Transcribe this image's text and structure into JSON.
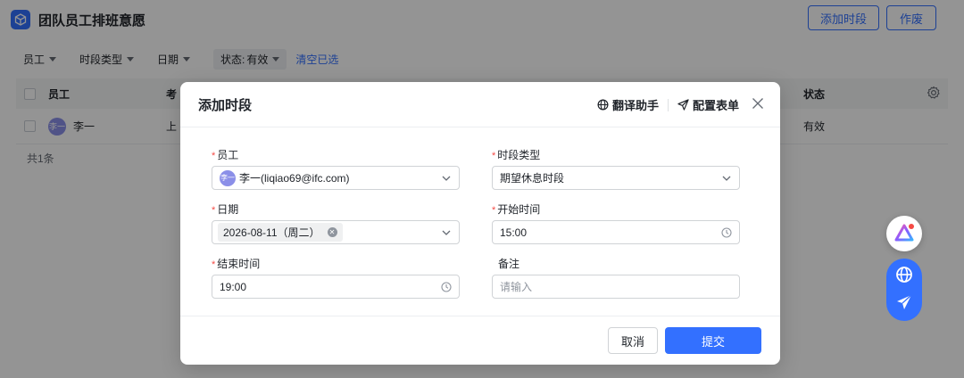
{
  "app": {
    "title": "团队员工排班意愿"
  },
  "toolbar": {
    "add_label": "添加时段",
    "void_label": "作废"
  },
  "filters": {
    "employee": "员工",
    "period_type": "时段类型",
    "date": "日期",
    "status_label": "状态:",
    "status_value": "有效",
    "clear": "清空已选"
  },
  "table": {
    "columns": {
      "employee": "员工",
      "attendance": "考",
      "status": "状态"
    },
    "rows": [
      {
        "avatar": "李一",
        "name": "李一",
        "attendance": "上",
        "status": "有效"
      }
    ],
    "total": "共1条"
  },
  "modal": {
    "title": "添加时段",
    "translate": "翻译助手",
    "config": "配置表单",
    "fields": {
      "employee": {
        "label": "员工",
        "avatar": "李一",
        "value": "李一(liqiao69@ifc.com)"
      },
      "period_type": {
        "label": "时段类型",
        "value": "期望休息时段"
      },
      "date": {
        "label": "日期",
        "value": "2026-08-11（周二）"
      },
      "start_time": {
        "label": "开始时间",
        "value": "15:00"
      },
      "end_time": {
        "label": "结束时间",
        "value": "19:00"
      },
      "remark": {
        "label": "备注",
        "placeholder": "请输入"
      }
    },
    "cancel": "取消",
    "submit": "提交"
  },
  "colors": {
    "primary": "#3370ff",
    "required": "#f54a45",
    "avatar": "#8b8fe8"
  }
}
